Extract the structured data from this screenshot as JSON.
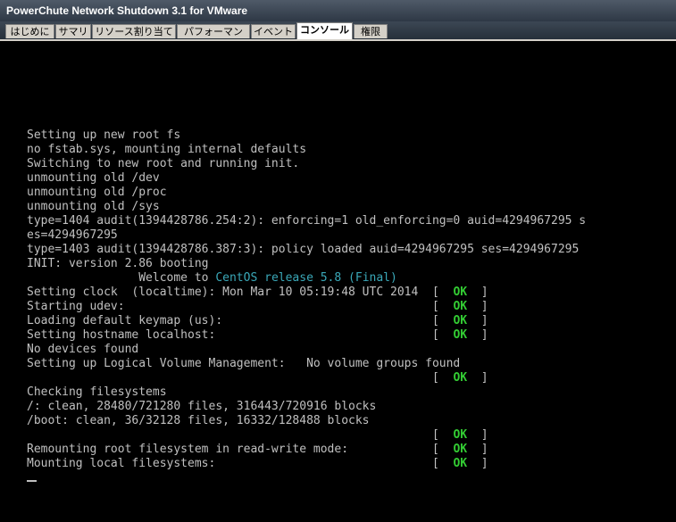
{
  "window": {
    "title": "PowerChute Network Shutdown 3.1 for VMware"
  },
  "tabs": [
    {
      "label": "はじめに",
      "active": false
    },
    {
      "label": "サマリ",
      "active": false
    },
    {
      "label": "リソース割り当て",
      "active": false
    },
    {
      "label": "パフォーマンス",
      "active": false
    },
    {
      "label": "イベント",
      "active": false
    },
    {
      "label": "コンソール",
      "active": true
    },
    {
      "label": "権限",
      "active": false
    }
  ],
  "console": {
    "lines": [
      [
        "Setting up new root fs"
      ],
      [
        "no fstab.sys, mounting internal defaults"
      ],
      [
        "Switching to new root and running init."
      ],
      [
        "unmounting old /dev"
      ],
      [
        "unmounting old /proc"
      ],
      [
        "unmounting old /sys"
      ],
      [
        "type=1404 audit(1394428786.254:2): enforcing=1 old_enforcing=0 auid=4294967295 s"
      ],
      [
        "es=4294967295"
      ],
      [
        "type=1403 audit(1394428786.387:3): policy loaded auid=4294967295 ses=4294967295"
      ],
      [
        "INIT: version 2.86 booting"
      ],
      [
        "                Welcome to ",
        "CentOS release 5.8 (Final)"
      ],
      [
        "Setting clock  (localtime): Mon Mar 10 05:19:48 UTC 2014  ",
        "[  ",
        "OK",
        "  ]"
      ],
      [
        "Starting udev:                                            ",
        "[  ",
        "OK",
        "  ]"
      ],
      [
        "Loading default keymap (us):                              ",
        "[  ",
        "OK",
        "  ]"
      ],
      [
        "Setting hostname localhost:                               ",
        "[  ",
        "OK",
        "  ]"
      ],
      [
        "No devices found"
      ],
      [
        "Setting up Logical Volume Management:   No volume groups found"
      ],
      [
        "                                                          ",
        "[  ",
        "OK",
        "  ]"
      ],
      [
        "Checking filesystems"
      ],
      [
        "/: clean, 28480/721280 files, 316443/720916 blocks"
      ],
      [
        "/boot: clean, 36/32128 files, 16332/128488 blocks"
      ],
      [
        "                                                          ",
        "[  ",
        "OK",
        "  ]"
      ],
      [
        "Remounting root filesystem in read-write mode:            ",
        "[  ",
        "OK",
        "  ]"
      ],
      [
        "Mounting local filesystems:                               ",
        "[  ",
        "OK",
        "  ]"
      ]
    ]
  },
  "colors": {
    "console_text": "#c0c0c0",
    "ok_green": "#33cc33",
    "release_cyan": "#3aa8b8"
  }
}
